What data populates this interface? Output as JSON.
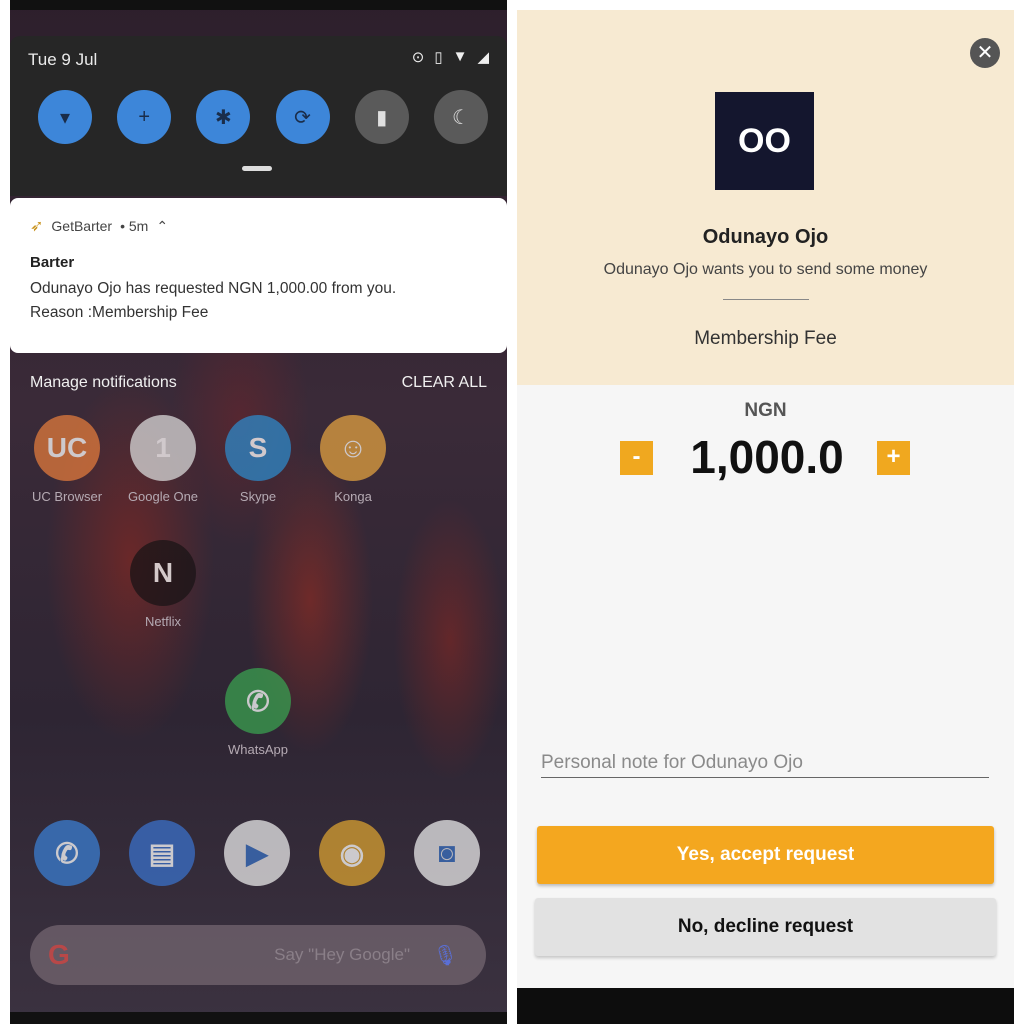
{
  "left": {
    "date": "Tue 9 Jul",
    "status_icons": [
      "sync-icon",
      "vibrate-icon",
      "wifi-icon",
      "signal-icon"
    ],
    "quick_settings": [
      {
        "name": "wifi",
        "icon": "▾",
        "state": "on"
      },
      {
        "name": "battery-saver",
        "icon": "+",
        "state": "on"
      },
      {
        "name": "bluetooth",
        "icon": "✱",
        "state": "on"
      },
      {
        "name": "auto-rotate",
        "icon": "⟳",
        "state": "on"
      },
      {
        "name": "flashlight",
        "icon": "▮",
        "state": "off"
      },
      {
        "name": "night-mode",
        "icon": "☾",
        "state": "off"
      }
    ],
    "notification": {
      "app": "GetBarter",
      "time": "• 5m",
      "title": "Barter",
      "line1": "Odunayo Ojo has requested NGN 1,000.00 from you.",
      "line2": "Reason :Membership Fee"
    },
    "manage_label": "Manage notifications",
    "clear_label": "CLEAR ALL",
    "apps": [
      {
        "label": "UC Browser",
        "glyph": "UC",
        "color": "#e07a3c"
      },
      {
        "label": "Google One",
        "glyph": "1",
        "color": "#d8d8d8"
      },
      {
        "label": "Skype",
        "glyph": "S",
        "color": "#2e88c8"
      },
      {
        "label": "Konga",
        "glyph": "☺",
        "color": "#e0a040"
      },
      {
        "label": "Netflix",
        "glyph": "N",
        "color": "#1a1416"
      },
      {
        "label": "WhatsApp",
        "glyph": "✆",
        "color": "#3aa050"
      }
    ],
    "dock": [
      {
        "name": "phone",
        "glyph": "✆",
        "color": "#3a7dd0"
      },
      {
        "name": "messages",
        "glyph": "▤",
        "color": "#3a70c8"
      },
      {
        "name": "play-store",
        "glyph": "▶",
        "color": "#e8e8e8"
      },
      {
        "name": "chrome",
        "glyph": "◉",
        "color": "#d8a030"
      },
      {
        "name": "camera",
        "glyph": "◙",
        "color": "#e8e8e8"
      }
    ],
    "search_hint": "Say \"Hey Google\""
  },
  "right": {
    "avatar_initials": "OO",
    "name": "Odunayo Ojo",
    "subtitle": "Odunayo Ojo wants you to send some money",
    "reason": "Membership Fee",
    "currency": "NGN",
    "minus": "-",
    "plus": "+",
    "amount": "1,000.0",
    "note_placeholder": "Personal note for Odunayo Ojo",
    "accept_label": "Yes, accept request",
    "decline_label": "No, decline request",
    "close_glyph": "✕"
  }
}
